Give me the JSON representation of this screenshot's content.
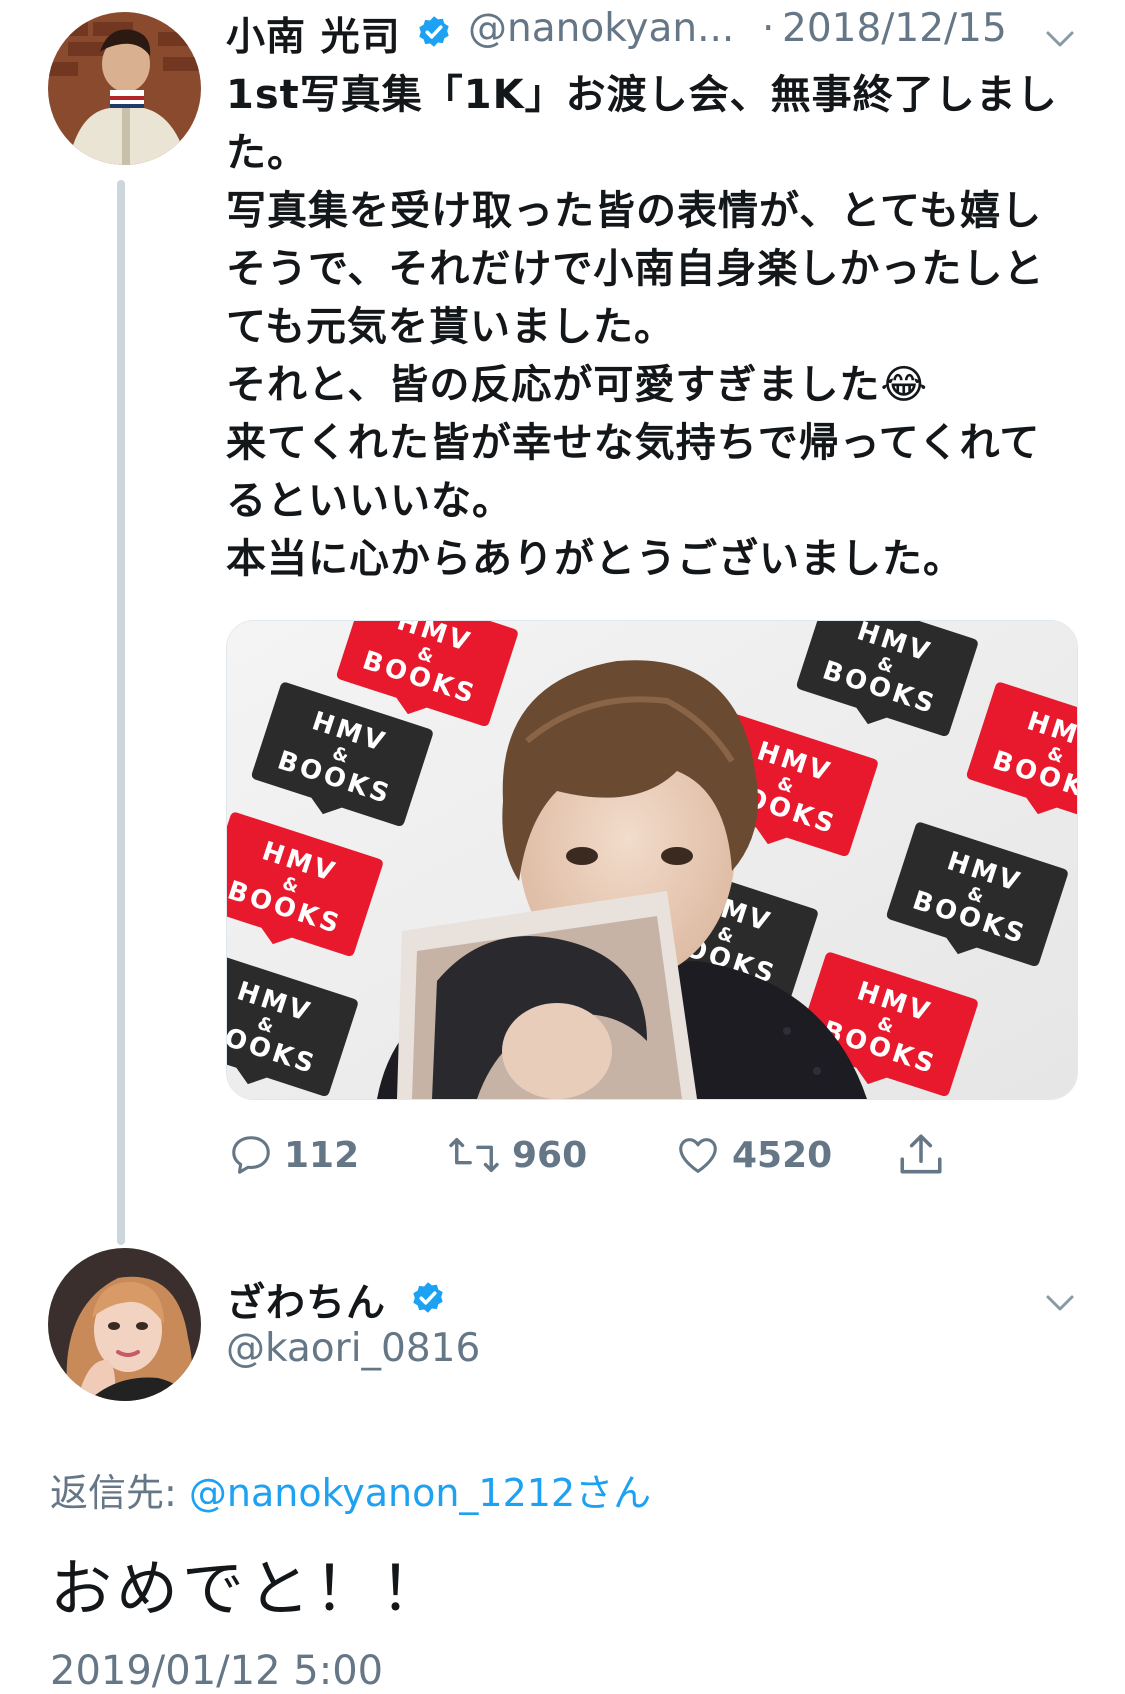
{
  "tweet": {
    "display_name": "小南 光司",
    "handle": "@nanokyan...",
    "separator": "·",
    "date": "2018/12/15",
    "lines": [
      "1st写真集「1K」お渡し会、無事終了しまし",
      "た。",
      "写真集を受け取った皆の表情が、とても嬉し",
      "そうで、それだけで小南自身楽しかったしと",
      "ても元気を貰いました。",
      "それと、皆の反応が可愛すぎました😂",
      "来てくれた皆が幸せな気持ちで帰ってくれて",
      "るといいいな。",
      "本当に心からありがとうございました。"
    ],
    "media_logos": [
      {
        "line1": "HMV",
        "line2": "&",
        "line3": "BOOKS"
      }
    ],
    "actions": {
      "replies": "112",
      "retweets": "960",
      "likes": "4520"
    }
  },
  "reply": {
    "display_name": "ざわちん",
    "handle": "@kaori_0816",
    "reply_label": "返信先: ",
    "reply_mention": "@nanokyanon_1212さん",
    "text": "おめでと！！",
    "timestamp": "2019/01/12 5:00"
  },
  "colors": {
    "verified_blue": "#1da1f2",
    "mention_blue": "#1da1f2",
    "muted": "#657786",
    "thread_line": "#ccd6dd",
    "hmv_red": "#e8192c",
    "hmv_black": "#2b2b2b"
  },
  "icons": {
    "verified": "verified-badge-icon",
    "chevron": "chevron-down-icon",
    "reply": "reply-bubble-icon",
    "retweet": "retweet-icon",
    "like": "heart-icon",
    "share": "share-icon"
  }
}
